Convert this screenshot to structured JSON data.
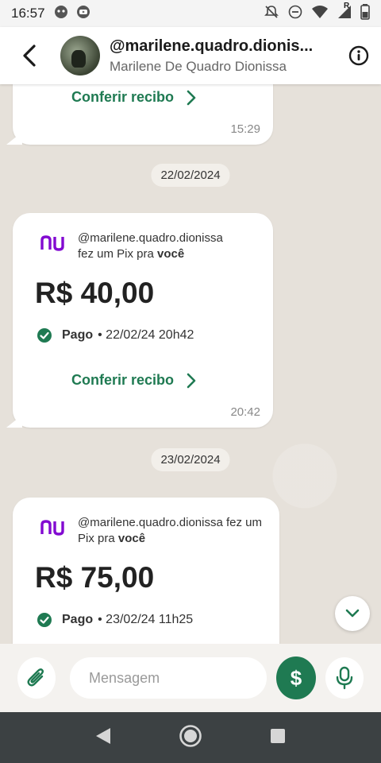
{
  "status_bar": {
    "time": "16:57",
    "icons": [
      "ghost-app-icon",
      "youtube-icon",
      "notification-off-icon",
      "dnd-icon",
      "wifi-icon",
      "signal-icon",
      "battery-icon"
    ],
    "signal_label": "R"
  },
  "header": {
    "title": "@marilene.quadro.dionis...",
    "subtitle": "Marilene De Quadro Dionissa"
  },
  "chat": {
    "messages": [
      {
        "type": "pix-partial",
        "recibo_label": "Conferir recibo",
        "time": "15:29"
      },
      {
        "type": "date",
        "label": "22/02/2024"
      },
      {
        "type": "pix",
        "sender": "@marilene.quadro.dionissa",
        "action_text": "fez um Pix pra",
        "recipient": "você",
        "amount": "R$ 40,00",
        "status": "Pago",
        "status_detail": "• 22/02/24 20h42",
        "recibo_label": "Conferir recibo",
        "time": "20:42"
      },
      {
        "type": "date",
        "label": "23/02/2024"
      },
      {
        "type": "pix",
        "sender": "@marilene.quadro.dionissa",
        "action_text": "fez um Pix pra",
        "recipient": "você",
        "amount": "R$ 75,00",
        "status": "Pago",
        "status_detail": "• 23/02/24 11h25"
      }
    ]
  },
  "composer": {
    "placeholder": "Mensagem",
    "pay_symbol": "$"
  },
  "colors": {
    "brand_green": "#1f7a52",
    "nubank_purple": "#820ad1",
    "chat_bg": "#e6e1da"
  }
}
